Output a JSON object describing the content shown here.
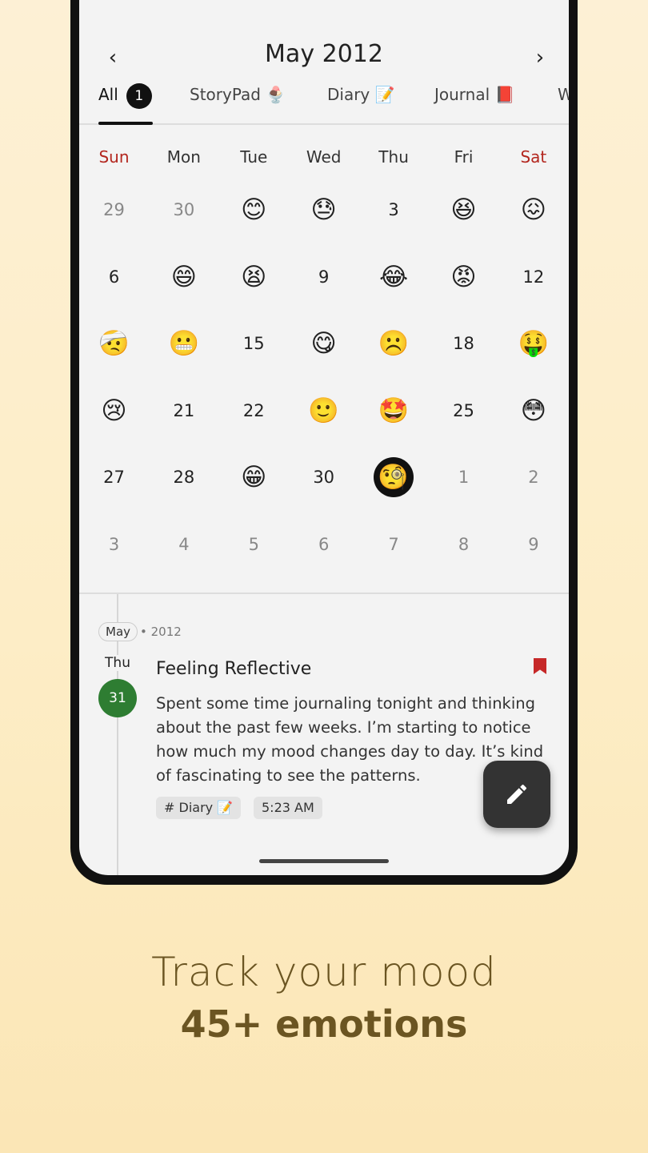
{
  "header": {
    "prev_icon": "‹",
    "title": "May 2012",
    "next_icon": "›"
  },
  "tabs": [
    {
      "label": "All",
      "badge": "1",
      "active": true
    },
    {
      "label": "StoryPad 🍨"
    },
    {
      "label": "Diary 📝"
    },
    {
      "label": "Journal 📕"
    },
    {
      "label": "W"
    }
  ],
  "weekdays": [
    "Sun",
    "Mon",
    "Tue",
    "Wed",
    "Thu",
    "Fri",
    "Sat"
  ],
  "calendar": [
    [
      "29",
      "30",
      "😊",
      "😓",
      "3",
      "😆",
      "😖"
    ],
    [
      "6",
      "😄",
      "😫",
      "9",
      "😂",
      "😡",
      "12"
    ],
    [
      "🤕",
      "😬",
      "15",
      "😋",
      "☹️",
      "18",
      "🤑"
    ],
    [
      "😢",
      "21",
      "22",
      "🙂",
      "🤩",
      "25",
      "😳"
    ],
    [
      "27",
      "28",
      "😁",
      "30",
      "🧐",
      "1",
      "2"
    ],
    [
      "3",
      "4",
      "5",
      "6",
      "7",
      "8",
      "9"
    ]
  ],
  "entry": {
    "month_chip": "May",
    "year": "• 2012",
    "weekday": "Thu",
    "day": "31",
    "title": "Feeling Reflective",
    "body": "Spent some time journaling tonight and thinking about the past few weeks. I’m starting to notice how much my mood changes day to day. It’s kind of fascinating to see the patterns.",
    "tag": "# Diary 📝",
    "time": "5:23 AM"
  },
  "tagline": {
    "line1": "Track your mood",
    "line2": "45+ emotions"
  },
  "colors": {
    "accent": "#2e7d32",
    "weekend": "#b3261e",
    "bookmark": "#c62828",
    "fab": "#333333"
  }
}
